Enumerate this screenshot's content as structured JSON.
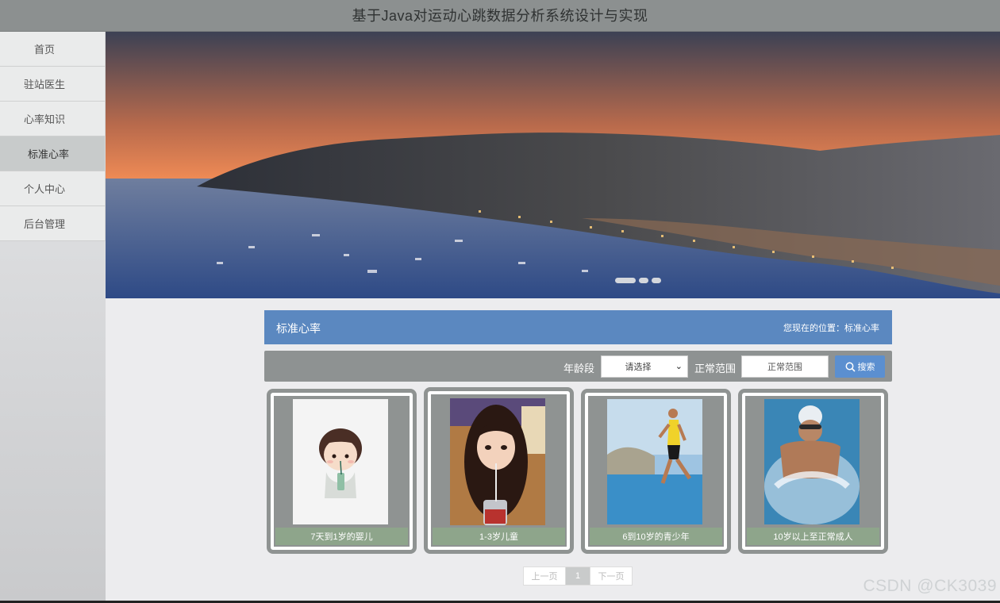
{
  "site": {
    "title": "基于Java对运动心跳数据分析系统设计与实现"
  },
  "sidebar": {
    "items": [
      {
        "label": "首页"
      },
      {
        "label": "驻站医生"
      },
      {
        "label": "心率知识"
      },
      {
        "label": "标准心率",
        "active": true
      },
      {
        "label": "个人中心"
      },
      {
        "label": "后台管理"
      }
    ]
  },
  "banner": {
    "slides": 3,
    "active_slide": 1
  },
  "breadcrumb": {
    "title": "标准心率",
    "location_prefix": "您现在的位置：",
    "location": "标准心率"
  },
  "search": {
    "age_label": "年龄段",
    "age_selected": "请选择",
    "range_label": "正常范围",
    "range_placeholder": "正常范围",
    "button_label": "搜索"
  },
  "cards": [
    {
      "caption": "7天到1岁的婴儿"
    },
    {
      "caption": "1-3岁儿童"
    },
    {
      "caption": "6到10岁的青少年"
    },
    {
      "caption": "10岁以上至正常成人"
    }
  ],
  "pagination": {
    "prev": "上一页",
    "current": "1",
    "next": "下一页"
  },
  "watermark": "CSDN @CK3039",
  "colors": {
    "header": "#8c9090",
    "accent_blue": "#5b88c0",
    "caption_green": "#8ea58b",
    "card_border": "#8f9392"
  }
}
